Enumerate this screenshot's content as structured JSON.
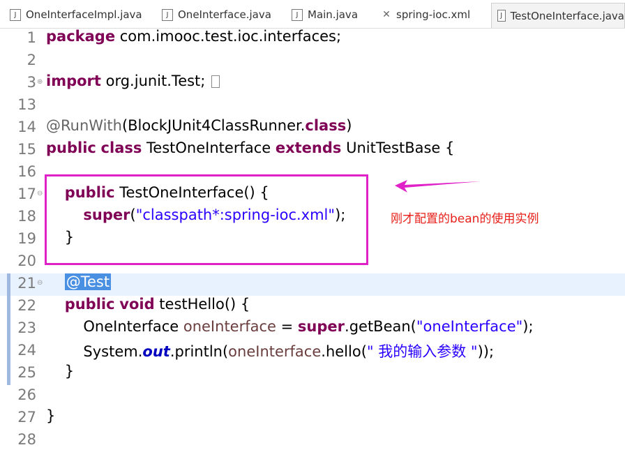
{
  "tabs": [
    {
      "label": "OneInterfaceImpl.java",
      "icon": "java-file-icon"
    },
    {
      "label": "OneInterface.java",
      "icon": "java-file-icon"
    },
    {
      "label": "Main.java",
      "icon": "java-file-icon"
    },
    {
      "label": "spring-ioc.xml",
      "icon": "xml-file-icon"
    },
    {
      "label": "TestOneInterface.java",
      "icon": "java-file-icon",
      "active": true
    }
  ],
  "lines": [
    {
      "num": "1",
      "code": "package com.imooc.test.ioc.interfaces;"
    },
    {
      "num": "2",
      "code": ""
    },
    {
      "num": "3",
      "code": "import org.junit.Test;"
    },
    {
      "num": "13",
      "code": ""
    },
    {
      "num": "14",
      "code": "@RunWith(BlockJUnit4ClassRunner.class)"
    },
    {
      "num": "15",
      "code": "public class TestOneInterface extends UnitTestBase {"
    },
    {
      "num": "16",
      "code": ""
    },
    {
      "num": "17",
      "code": "    public TestOneInterface() {"
    },
    {
      "num": "18",
      "code": "        super(\"classpath*:spring-ioc.xml\");"
    },
    {
      "num": "19",
      "code": "    }"
    },
    {
      "num": "20",
      "code": ""
    },
    {
      "num": "21",
      "code": "    @Test"
    },
    {
      "num": "22",
      "code": "    public void testHello() {"
    },
    {
      "num": "23",
      "code": "        OneInterface oneInterface = super.getBean(\"oneInterface\");"
    },
    {
      "num": "24",
      "code": "        System.out.println(oneInterface.hello(\" 我的输入参数 \"));"
    },
    {
      "num": "25",
      "code": "    }"
    },
    {
      "num": "26",
      "code": ""
    },
    {
      "num": "27",
      "code": "}"
    },
    {
      "num": "28",
      "code": ""
    }
  ],
  "annotation": {
    "text": "刚才配置的bean的使用实例",
    "color": "#e8201a",
    "box_color": "#e021c8"
  },
  "colors": {
    "keyword": "#7f0055",
    "string": "#2a00ff",
    "annotation": "#646464",
    "field": "#6a3e3e",
    "static_field": "#0000c0",
    "current_line": "#e8f2fe",
    "selection": "#4a90e2"
  }
}
